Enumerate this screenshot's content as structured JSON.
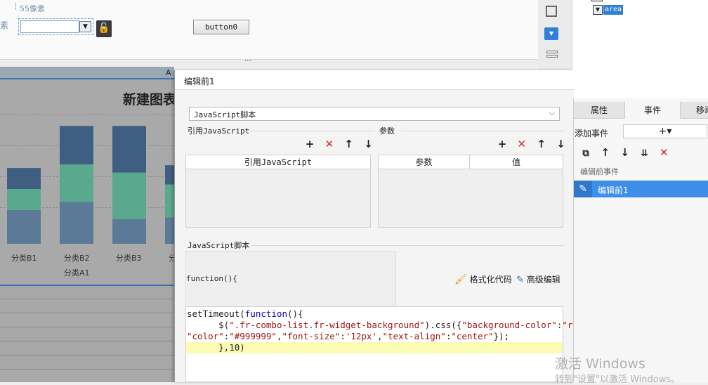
{
  "canvas": {
    "px_label": "55像素",
    "side_label": "素",
    "button_label": "button0",
    "sep_dots": "···"
  },
  "tree": {
    "item_label": "area"
  },
  "sheet": {
    "col_letter": "A",
    "chart": {
      "title": "新建图表",
      "x_labels": [
        "分类B1",
        "分类B2",
        "分类B3",
        "分"
      ],
      "group_label": "分类A1"
    }
  },
  "chart_data": {
    "type": "bar",
    "title": "新建图表",
    "categories": [
      "分类B1",
      "分类B2",
      "分类B3",
      "分"
    ],
    "group": "分类A1",
    "series": [
      {
        "values": [
          37,
          46,
          27,
          29
        ],
        "color": "#5a7a98"
      },
      {
        "values": [
          23,
          41,
          51,
          36
        ],
        "color": "#5aa88e"
      },
      {
        "values": [
          23,
          42,
          51,
          21
        ],
        "color": "#3e5f82"
      }
    ],
    "ylim": [
      0,
      140
    ]
  },
  "dialog": {
    "title": "编辑前1",
    "type_select": "JavaScript脚本",
    "ref_section": "引用JavaScript",
    "ref_column": "引用JavaScript",
    "param_section": "参数",
    "param_col1": "参数",
    "param_col2": "值",
    "script_section": "JavaScript脚本",
    "function_header": "function(){",
    "format_code": "格式化代码",
    "advanced_edit": "高级编辑",
    "code": {
      "line1_a": "setTimeout(",
      "line1_kw": "function",
      "line1_b": "(){",
      "line2_a": "      $(",
      "line2_str": "\".fr-combo-list.fr-widget-background\"",
      "line2_b": ").css({",
      "line2_str2": "\"background-color\"",
      "line2_c": ":",
      "line2_str3": "\"red\"",
      "line2_d": ",",
      "line3_s1": "\"color\"",
      "line3_c1": ":",
      "line3_s2": "\"#999999\"",
      "line3_c2": ",",
      "line3_s3": "\"font-size\"",
      "line3_c3": ":",
      "line3_s4": "'12px'",
      "line3_c4": ",",
      "line3_s5": "\"text-align\"",
      "line3_c5": ":",
      "line3_s6": "\"center\"",
      "line3_c6": "});",
      "line4": "      },10)"
    }
  },
  "right_panel": {
    "tabs": [
      "属性",
      "事件",
      "移动"
    ],
    "add_event_label": "添加事件",
    "add_symbol": "+▾",
    "group_label": "编辑前事件",
    "event_item": "编辑前1"
  },
  "watermark": {
    "line1": "激活 Windows",
    "line2": "转到\"设置\"以激活 Windows。"
  }
}
